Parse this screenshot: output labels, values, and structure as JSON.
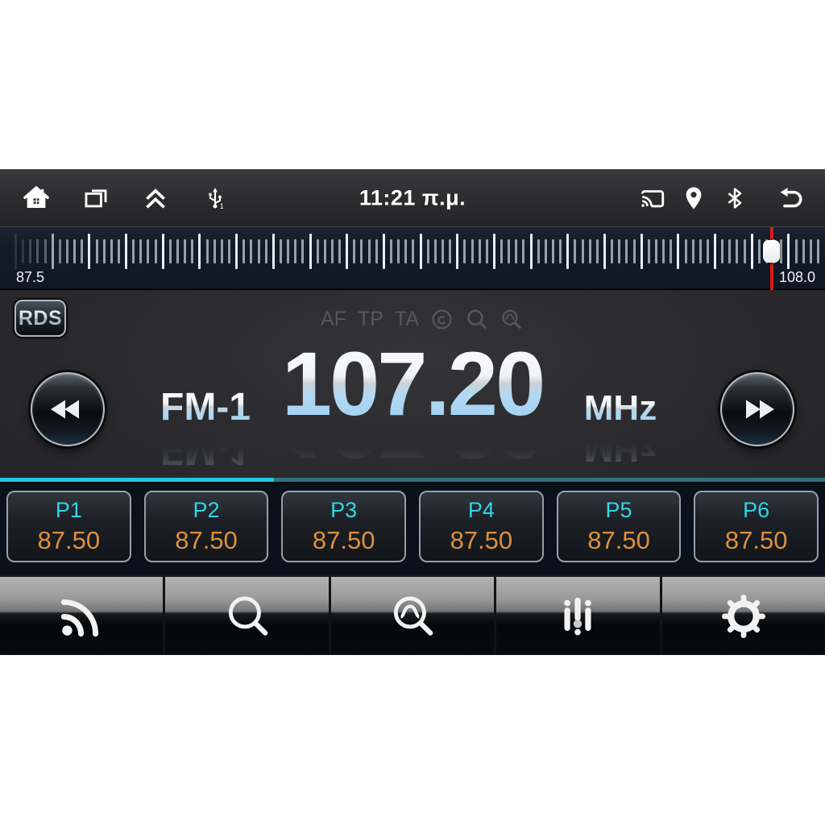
{
  "status_bar": {
    "time": "11:21 π.μ.",
    "icons_left": [
      "home-icon",
      "recent-apps-icon",
      "chevrons-up-icon",
      "usb-icon"
    ],
    "usb_badge": "1",
    "icons_right": [
      "cast-icon",
      "location-icon",
      "bluetooth-icon",
      "back-icon"
    ]
  },
  "tuner_scale": {
    "min": 87.5,
    "max": 108.0,
    "value": 107.2,
    "min_label": "87.5",
    "max_label": "108.0",
    "tick_count": 110,
    "major_every": 5
  },
  "radio": {
    "rds_label": "RDS",
    "indicators": [
      "AF",
      "TP",
      "TA"
    ],
    "indicator_icons": [
      "loop-circle-icon",
      "magnifier-icon",
      "magnifier-wave-icon"
    ],
    "band": "FM-1",
    "frequency": "107.20",
    "unit": "MHz"
  },
  "divider": {
    "progress_percent": 33.2
  },
  "presets": [
    {
      "label": "P1",
      "value": "87.50"
    },
    {
      "label": "P2",
      "value": "87.50"
    },
    {
      "label": "P3",
      "value": "87.50"
    },
    {
      "label": "P4",
      "value": "87.50"
    },
    {
      "label": "P5",
      "value": "87.50"
    },
    {
      "label": "P6",
      "value": "87.50"
    }
  ],
  "toolbar": [
    "broadcast-icon",
    "magnifier-icon",
    "magnifier-wave-icon",
    "equalizer-icon",
    "settings-gear-icon"
  ],
  "colors": {
    "divider_bright": "#1bcadd",
    "divider_dim": "#2e7280",
    "preset_label_cyan": "#31d4e6",
    "preset_value_orange": "#de9040",
    "indicator_red": "#d91b17",
    "dim_indicator_gray": "#54595e",
    "freq_gradient_blue": "#a5d3f2"
  }
}
